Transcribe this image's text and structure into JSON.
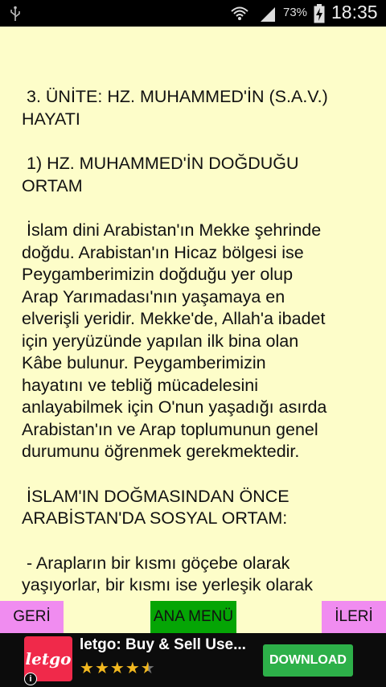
{
  "status_bar": {
    "battery_percent": "73%",
    "time": "18:35"
  },
  "content": {
    "paragraphs": [
      " 3. ÜNİTE: HZ. MUHAMMED'İN (S.A.V.)\nHAYATI",
      " 1) HZ. MUHAMMED'İN DOĞDUĞU\nORTAM",
      " İslam dini Arabistan'ın Mekke şehrinde\ndoğdu. Arabistan'ın Hicaz bölgesi ise\nPeygamberimizin doğduğu yer olup\nArap Yarımadası'nın yaşamaya en\nelverişli yeridir. Mekke'de, Allah'a ibadet\niçin yeryüzünde yapılan ilk bina olan\nKâbe bulunur. Peygamberimizin\nhayatını ve tebliğ mücadelesini\nanlayabilmek için O'nun yaşadığı asırda\nArabistan'ın ve Arap toplumunun genel\ndurumunu öğrenmek gerekmektedir.",
      " İSLAM'IN DOĞMASINDAN ÖNCE\nARABİSTAN'DA SOSYAL ORTAM:",
      " - Arapların bir kısmı göçebe olarak\nyaşıyorlar, bir kısmı ise yerleşik olarak"
    ]
  },
  "nav": {
    "back_label": "GERİ",
    "home_label": "ANA MENÜ",
    "next_label": "İLERİ",
    "colors": {
      "side": "#f08cf0",
      "home": "#05a505"
    }
  },
  "ad": {
    "logo_text": "letgo",
    "title": "letgo: Buy & Sell Use...",
    "rating_stars": 4.5,
    "download_label": "DOWNLOAD",
    "info_label": "i",
    "colors": {
      "logo": "#f0294a",
      "button": "#2db049",
      "stars": "#f2b81f"
    }
  }
}
